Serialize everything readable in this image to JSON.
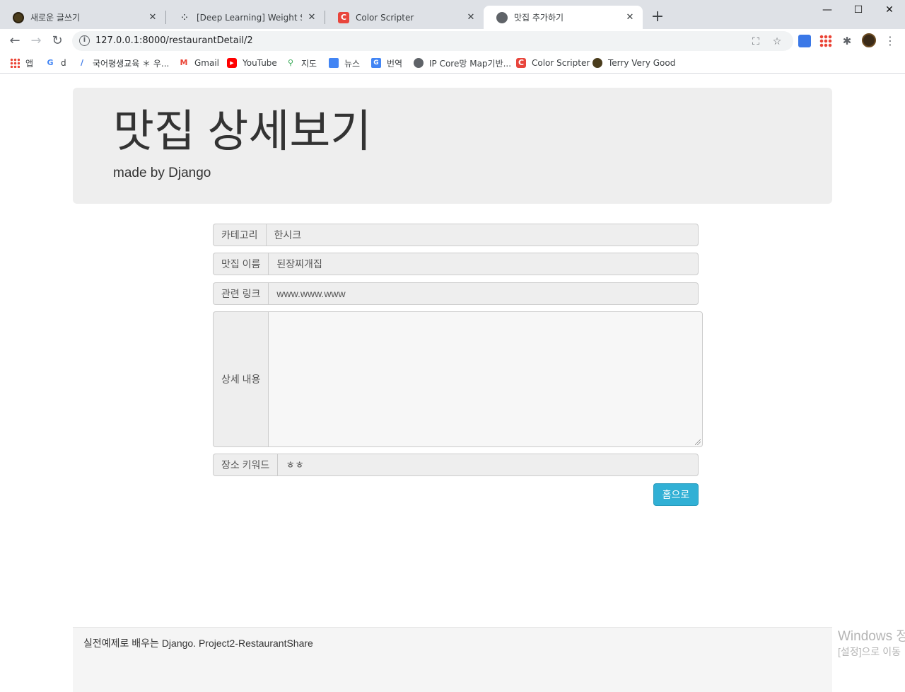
{
  "browser": {
    "tabs": [
      {
        "title": "새로운 글쓰기",
        "icon": "avatar-icon"
      },
      {
        "title": "[Deep Learning] Weight Standar",
        "icon": "dots-icon"
      },
      {
        "title": "Color Scripter",
        "icon": "color-scripter-icon"
      },
      {
        "title": "맛집 추가하기",
        "icon": "globe-icon"
      }
    ],
    "active_tab": 3,
    "url": "127.0.0.1:8000/restaurantDetail/2",
    "bookmarks": [
      {
        "label": "앱",
        "icon": "apps-icon"
      },
      {
        "label": "d",
        "icon": "google-icon"
      },
      {
        "label": "국어평생교육 ＊ 우...",
        "icon": "link-icon"
      },
      {
        "label": "Gmail",
        "icon": "gmail-icon"
      },
      {
        "label": "YouTube",
        "icon": "youtube-icon"
      },
      {
        "label": "지도",
        "icon": "maps-icon"
      },
      {
        "label": "뉴스",
        "icon": "news-icon"
      },
      {
        "label": "번역",
        "icon": "translate-icon"
      },
      {
        "label": "IP Core망 Map기반...",
        "icon": "globe-icon"
      },
      {
        "label": "Color Scripter",
        "icon": "color-scripter-icon"
      },
      {
        "label": "Terry Very Good",
        "icon": "avatar-icon"
      }
    ],
    "colors": {
      "tabbar": "#dee1e6",
      "omnibox": "#f1f3f4"
    }
  },
  "page": {
    "title": "맛집 상세보기",
    "subtitle": "made by Django",
    "fields": {
      "category": {
        "label": "카테고리",
        "value": "한시크"
      },
      "name": {
        "label": "맛집 이름",
        "value": "된장찌개집"
      },
      "link": {
        "label": "관련 링크",
        "value": "www.www.www"
      },
      "content": {
        "label": "상세 내용",
        "value": ""
      },
      "keyword": {
        "label": "장소 키워드",
        "value": "ㅎㅎ"
      }
    },
    "home_button": "홈으로",
    "footer_text": "실전예제로 배우는 Django. Project2-RestaurantShare",
    "colors": {
      "button": "#31b0d5",
      "jumbotron": "#eeeeee"
    }
  },
  "watermark": {
    "line1": "Windows 정",
    "line2": "[설정]으로 이동"
  }
}
